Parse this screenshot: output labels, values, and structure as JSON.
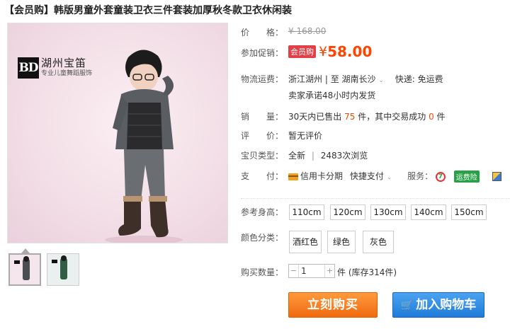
{
  "title": "【会员购】韩版男童外套童装卫衣三件套装加厚秋冬款卫衣休闲装",
  "image": {
    "logo_mark": "BD",
    "logo_name": "湖州宝笛",
    "logo_sub": "专业儿童舞蹈服饰"
  },
  "price": {
    "label": "价　　格：",
    "original": "¥ 168.00"
  },
  "promo": {
    "label": "参加促销：",
    "badge": "会员购",
    "currency": "¥",
    "amount": "58.00"
  },
  "shipping": {
    "label": "物流运费：",
    "route_from": "浙江湖州",
    "route_sep": "| 至",
    "route_to": "湖南长沙",
    "fee": "快递: 免运费",
    "promise": "卖家承诺48小时内发货"
  },
  "sales": {
    "label": "销　　量：",
    "prefix": "30天内已售出",
    "count": "75",
    "mid": "件，其中交易成功",
    "success": "0",
    "suffix": "件"
  },
  "rating": {
    "label": "评　　价：",
    "value": "暂无评价"
  },
  "item_type": {
    "label": "宝贝类型：",
    "value": "全新",
    "sep": "|",
    "views": "2483次浏览"
  },
  "payment": {
    "label": "支　　付：",
    "credit": "信用卡分期",
    "quick": "快捷支付",
    "service_label": "服务：",
    "service_7": "7",
    "service_badge": "运费险"
  },
  "sizes": {
    "label": "参考身高：",
    "options": [
      "110cm",
      "120cm",
      "130cm",
      "140cm",
      "150cm"
    ]
  },
  "colors": {
    "label": "颜色分类：",
    "options": [
      "酒红色",
      "绿色",
      "灰色"
    ]
  },
  "quantity": {
    "label": "购买数量：",
    "value": "1",
    "stock": "件 (库存314件)"
  },
  "actions": {
    "buy": "立刻购买",
    "cart": "加入购物车"
  },
  "colors_ui": {
    "price": "#ff4400",
    "buy_button": "#f37a1f",
    "cart_button": "#2f8ee5",
    "vip_badge": "#e14046"
  }
}
